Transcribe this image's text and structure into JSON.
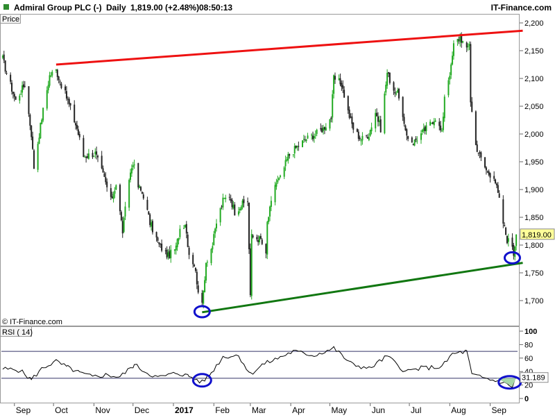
{
  "header": {
    "instrument": "Admiral Group PLC (-)",
    "period": "Daily",
    "quote": "1,819.00 (+2.48%)",
    "time": "08:50:13",
    "brand": "IT-Finance.com"
  },
  "price_panel": {
    "label": "Price",
    "watermark": "© IT-Finance.com",
    "last_price_label": "1,819.00",
    "y_ticks": [
      "2,200",
      "2,150",
      "2,100",
      "2,050",
      "2,000",
      "1,950",
      "1,900",
      "1,850",
      "1,800",
      "1,750",
      "1,700"
    ]
  },
  "rsi_panel": {
    "label": "RSI ( 14)",
    "value_label": "31.189",
    "y_ticks": [
      "100",
      "80",
      "60",
      "40",
      "20",
      "0"
    ]
  },
  "x_axis": {
    "ticks": [
      "Sep",
      "Oct",
      "Nov",
      "Dec",
      "2017",
      "Feb",
      "Mar",
      "Apr",
      "May",
      "Jun",
      "Jul",
      "Aug",
      "Sep"
    ]
  },
  "colors": {
    "resistance": "#ee1111",
    "support": "#117711",
    "highlight": "#1010cc",
    "candle_up": "#22aa22",
    "candle_down": "#222222",
    "last_price_bg": "#ffff99",
    "rsi_line": "#000000"
  },
  "chart_data": [
    {
      "type": "candlestick",
      "title": "Admiral Group PLC (-) Daily",
      "ylabel": "Price",
      "ylim": [
        1655,
        2215
      ],
      "x_range": [
        "2016-08-22",
        "2017-09-22"
      ],
      "grid": false,
      "series": [
        {
          "name": "Admiral Group PLC (-)",
          "path": [
            [
              "2016-08-23",
              2135
            ],
            [
              "2016-08-26",
              2110
            ],
            [
              "2016-09-02",
              2060
            ],
            [
              "2016-09-09",
              2090
            ],
            [
              "2016-09-14",
              2000
            ],
            [
              "2016-09-16",
              1940
            ],
            [
              "2016-09-22",
              2030
            ],
            [
              "2016-09-28",
              2105
            ],
            [
              "2016-10-03",
              2115
            ],
            [
              "2016-10-06",
              2095
            ],
            [
              "2016-10-12",
              2060
            ],
            [
              "2016-10-19",
              2010
            ],
            [
              "2016-10-24",
              1960
            ],
            [
              "2016-11-02",
              1965
            ],
            [
              "2016-11-09",
              1920
            ],
            [
              "2016-11-14",
              1880
            ],
            [
              "2016-11-18",
              1910
            ],
            [
              "2016-11-23",
              1825
            ],
            [
              "2016-11-28",
              1920
            ],
            [
              "2016-12-01",
              1950
            ],
            [
              "2016-12-05",
              1905
            ],
            [
              "2016-12-09",
              1890
            ],
            [
              "2016-12-14",
              1840
            ],
            [
              "2016-12-21",
              1800
            ],
            [
              "2016-12-28",
              1780
            ],
            [
              "2017-01-03",
              1795
            ],
            [
              "2017-01-06",
              1830
            ],
            [
              "2017-01-10",
              1840
            ],
            [
              "2017-01-13",
              1785
            ],
            [
              "2017-01-17",
              1765
            ],
            [
              "2017-01-20",
              1720
            ],
            [
              "2017-01-23",
              1690
            ],
            [
              "2017-01-26",
              1770
            ],
            [
              "2017-01-31",
              1800
            ],
            [
              "2017-02-03",
              1840
            ],
            [
              "2017-02-08",
              1880
            ],
            [
              "2017-02-13",
              1890
            ],
            [
              "2017-02-17",
              1860
            ],
            [
              "2017-02-21",
              1870
            ],
            [
              "2017-02-27",
              1880
            ],
            [
              "2017-03-01",
              1710
            ],
            [
              "2017-03-02",
              1815
            ],
            [
              "2017-03-09",
              1810
            ],
            [
              "2017-03-13",
              1780
            ],
            [
              "2017-03-14",
              1840
            ],
            [
              "2017-03-20",
              1910
            ],
            [
              "2017-03-24",
              1920
            ],
            [
              "2017-03-30",
              1960
            ],
            [
              "2017-04-05",
              1975
            ],
            [
              "2017-04-12",
              1990
            ],
            [
              "2017-04-20",
              2000
            ],
            [
              "2017-04-26",
              2010
            ],
            [
              "2017-05-02",
              2030
            ],
            [
              "2017-05-04",
              2100
            ],
            [
              "2017-05-10",
              2090
            ],
            [
              "2017-05-15",
              2040
            ],
            [
              "2017-05-19",
              2010
            ],
            [
              "2017-05-25",
              1990
            ],
            [
              "2017-05-31",
              2000
            ],
            [
              "2017-06-05",
              2040
            ],
            [
              "2017-06-09",
              2010
            ],
            [
              "2017-06-14",
              2110
            ],
            [
              "2017-06-19",
              2080
            ],
            [
              "2017-06-23",
              2070
            ],
            [
              "2017-06-28",
              2000
            ],
            [
              "2017-07-04",
              1985
            ],
            [
              "2017-07-10",
              2000
            ],
            [
              "2017-07-14",
              2010
            ],
            [
              "2017-07-21",
              2030
            ],
            [
              "2017-07-26",
              2000
            ],
            [
              "2017-07-28",
              2070
            ],
            [
              "2017-08-02",
              2120
            ],
            [
              "2017-08-04",
              2160
            ],
            [
              "2017-08-09",
              2175
            ],
            [
              "2017-08-14",
              2150
            ],
            [
              "2017-08-16",
              2165
            ],
            [
              "2017-08-17",
              2060
            ],
            [
              "2017-08-21",
              1980
            ],
            [
              "2017-08-25",
              1955
            ],
            [
              "2017-08-30",
              1930
            ],
            [
              "2017-09-04",
              1925
            ],
            [
              "2017-09-08",
              1880
            ],
            [
              "2017-09-11",
              1840
            ],
            [
              "2017-09-14",
              1810
            ],
            [
              "2017-09-18",
              1800
            ],
            [
              "2017-09-19",
              1785
            ],
            [
              "2017-09-21",
              1819
            ]
          ]
        }
      ],
      "annotations": [
        {
          "type": "trendline",
          "name": "resistance",
          "from": [
            "2016-10-03",
            2125
          ],
          "to": [
            "2017-09-26",
            2186
          ]
        },
        {
          "type": "trendline",
          "name": "support",
          "from": [
            "2017-01-23",
            1679
          ],
          "to": [
            "2017-09-26",
            1768
          ]
        },
        {
          "type": "circle",
          "at": [
            "2017-01-23",
            1680
          ]
        },
        {
          "type": "circle",
          "at": [
            "2017-09-18",
            1777
          ]
        }
      ]
    },
    {
      "type": "line",
      "title": "RSI ( 14)",
      "ylim": [
        0,
        100
      ],
      "x_range": [
        "2016-08-22",
        "2017-09-22"
      ],
      "reference_lines": [
        70,
        30
      ],
      "series": [
        {
          "name": "RSI ( 14)",
          "points": [
            [
              "2016-08-23",
              44
            ],
            [
              "2016-09-05",
              42
            ],
            [
              "2016-09-14",
              28
            ],
            [
              "2016-09-23",
              46
            ],
            [
              "2016-10-03",
              55
            ],
            [
              "2016-10-12",
              46
            ],
            [
              "2016-10-21",
              38
            ],
            [
              "2016-10-31",
              32
            ],
            [
              "2016-11-10",
              35
            ],
            [
              "2016-11-21",
              32
            ],
            [
              "2016-12-02",
              50
            ],
            [
              "2016-12-12",
              38
            ],
            [
              "2016-12-20",
              31
            ],
            [
              "2017-01-04",
              38
            ],
            [
              "2017-01-13",
              33
            ],
            [
              "2017-01-23",
              24
            ],
            [
              "2017-01-30",
              38
            ],
            [
              "2017-02-08",
              62
            ],
            [
              "2017-02-20",
              64
            ],
            [
              "2017-03-01",
              36
            ],
            [
              "2017-03-10",
              50
            ],
            [
              "2017-03-20",
              58
            ],
            [
              "2017-04-03",
              70
            ],
            [
              "2017-04-19",
              64
            ],
            [
              "2017-05-04",
              75
            ],
            [
              "2017-05-17",
              52
            ],
            [
              "2017-05-31",
              44
            ],
            [
              "2017-06-14",
              63
            ],
            [
              "2017-06-28",
              40
            ],
            [
              "2017-07-10",
              45
            ],
            [
              "2017-07-26",
              47
            ],
            [
              "2017-08-03",
              66
            ],
            [
              "2017-08-14",
              70
            ],
            [
              "2017-08-18",
              35
            ],
            [
              "2017-08-30",
              29
            ],
            [
              "2017-09-08",
              25
            ],
            [
              "2017-09-18",
              18
            ],
            [
              "2017-09-21",
              31.189
            ]
          ]
        }
      ]
    }
  ]
}
